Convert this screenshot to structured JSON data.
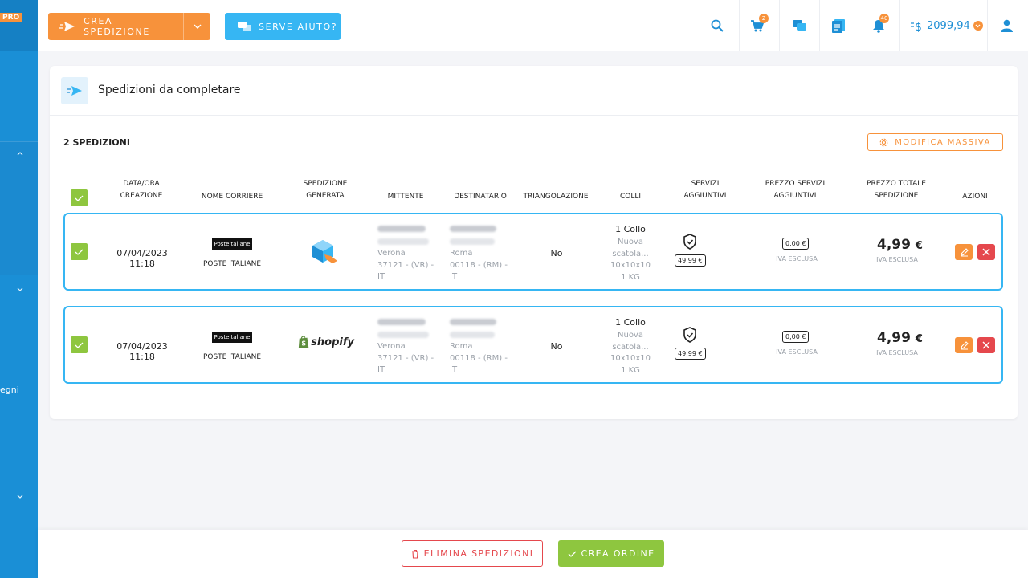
{
  "sidebar": {
    "badge": "PRO",
    "partial_label": "egni"
  },
  "topbar": {
    "create_label": "CREA SPEDIZIONE",
    "help_label": "SERVE AIUTO?",
    "cart_count": "2",
    "notifications_count": "40",
    "balance": "2099,94",
    "icons": [
      "search-icon",
      "cart-icon",
      "chat-icon",
      "document-icon",
      "bell-icon",
      "wallet-icon",
      "user-icon"
    ]
  },
  "card": {
    "title": "Spedizioni da completare",
    "count_label": "2 SPEDIZIONI",
    "mass_edit_label": "MODIFICA MASSIVA",
    "columns": {
      "date": [
        "DATA/ORA",
        "CREAZIONE"
      ],
      "courier": "NOME CORRIERE",
      "generated": [
        "SPEDIZIONE",
        "GENERATA"
      ],
      "sender": "MITTENTE",
      "recipient": "DESTINATARIO",
      "triangulation": "TRIANGOLAZIONE",
      "packages": "COLLI",
      "services": [
        "SERVIZI",
        "AGGIUNTIVI"
      ],
      "services_price": [
        "PREZZO SERVIZI",
        "AGGIUNTIVI"
      ],
      "total_price": [
        "PREZZO TOTALE",
        "SPEDIZIONE"
      ],
      "actions": "AZIONI"
    },
    "rows": [
      {
        "date": "07/04/2023 11:18",
        "courier_logo": "PosteItaliane",
        "courier": "POSTE ITALIANE",
        "generated": "box-icon",
        "sender": [
          "Verona",
          "37121 - (VR) -",
          "IT"
        ],
        "recipient": [
          "Roma",
          "00118 - (RM) -",
          "IT"
        ],
        "triangulation": "No",
        "packages_title": "1 Collo",
        "packages_desc": [
          "Nuova",
          "scatola...",
          "10x10x10",
          "1 KG"
        ],
        "service_price": "49,99 €",
        "services_price": "0,00 €",
        "services_vat": "IVA ESCLUSA",
        "total": "4,99",
        "currency": "€",
        "total_vat": "IVA ESCLUSA"
      },
      {
        "date": "07/04/2023 11:18",
        "courier_logo": "PosteItaliane",
        "courier": "POSTE ITALIANE",
        "generated": "shopify",
        "sender": [
          "Verona",
          "37121 - (VR) -",
          "IT"
        ],
        "recipient": [
          "Roma",
          "00118 - (RM) -",
          "IT"
        ],
        "triangulation": "No",
        "packages_title": "1 Collo",
        "packages_desc": [
          "Nuova",
          "scatola...",
          "10x10x10",
          "1 KG"
        ],
        "service_price": "49,99 €",
        "services_price": "0,00 €",
        "services_vat": "IVA ESCLUSA",
        "total": "4,99",
        "currency": "€",
        "total_vat": "IVA ESCLUSA"
      }
    ]
  },
  "bottombar": {
    "delete_label": "ELIMINA SPEDIZIONI",
    "order_label": "CREA ORDINE"
  },
  "colors": {
    "orange": "#f7923b",
    "blue": "#1a8fd6",
    "light_blue": "#36b6f3",
    "green": "#8ec63f",
    "red": "#e5484d"
  }
}
